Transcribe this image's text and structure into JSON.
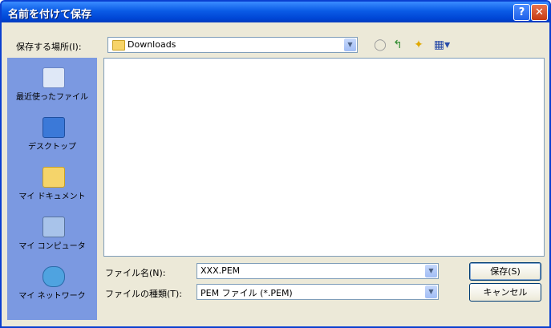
{
  "window": {
    "title": "名前を付けて保存",
    "help_label": "?",
    "close_label": "✕"
  },
  "save_in": {
    "label": "保存する場所(I):",
    "value": "Downloads"
  },
  "toolbar": {
    "back_icon": "back-icon",
    "up_icon": "up-folder-icon",
    "new_folder_icon": "new-folder-icon",
    "views_icon": "views-menu-icon"
  },
  "places": [
    {
      "label": "最近使ったファイル",
      "icon": "recent-icon"
    },
    {
      "label": "デスクトップ",
      "icon": "desktop-icon"
    },
    {
      "label": "マイ ドキュメント",
      "icon": "my-documents-icon"
    },
    {
      "label": "マイ コンピュータ",
      "icon": "my-computer-icon"
    },
    {
      "label": "マイ ネットワーク",
      "icon": "my-network-icon"
    }
  ],
  "file_name": {
    "label": "ファイル名(N):",
    "value": "XXX.PEM"
  },
  "file_type": {
    "label": "ファイルの種類(T):",
    "value": "PEM ファイル (*.PEM)"
  },
  "buttons": {
    "save": "保存(S)",
    "cancel": "キャンセル"
  },
  "colors": {
    "titlebar": "#0a5be6",
    "places_bar": "#7b99e1",
    "dialog_bg": "#ece9d8"
  }
}
